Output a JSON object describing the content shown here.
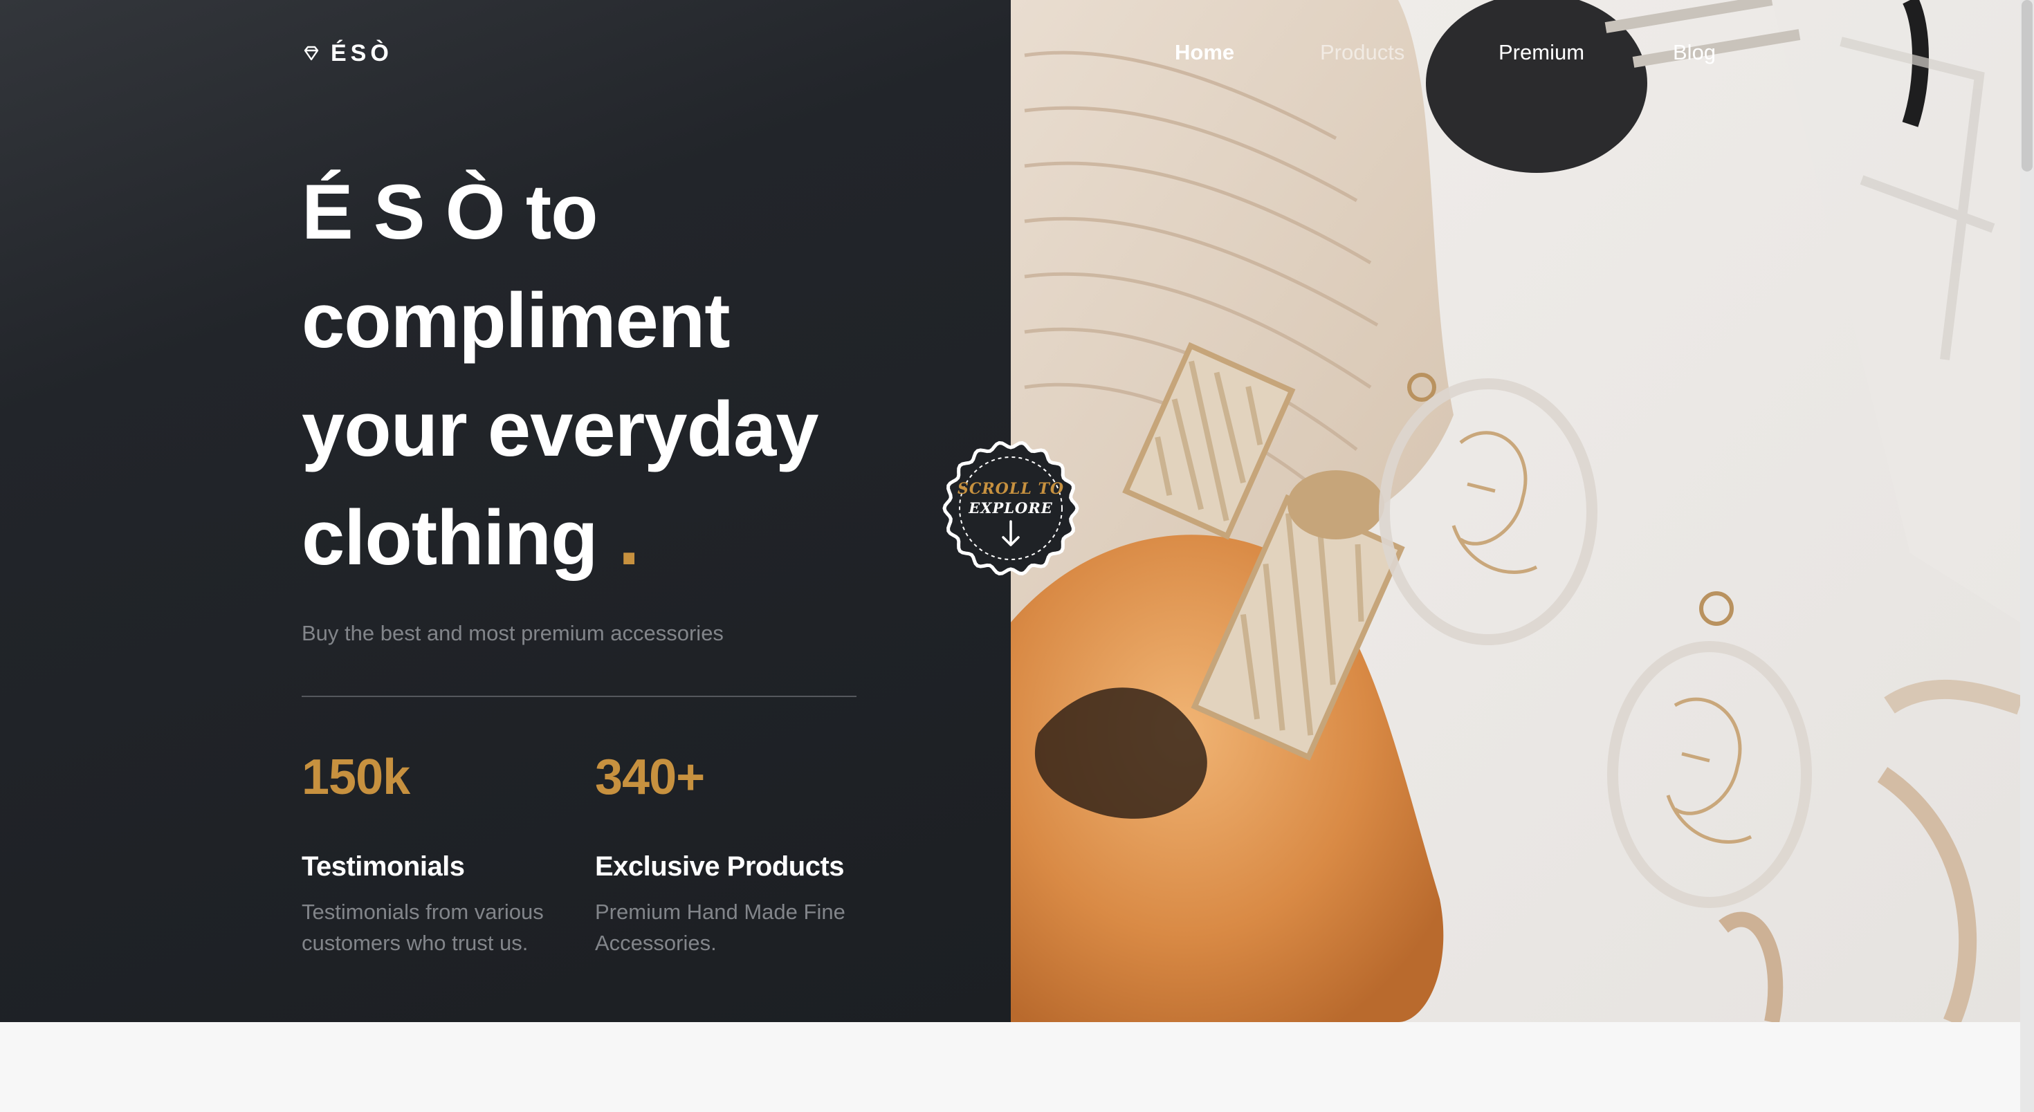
{
  "brand": {
    "logo_text": "ÉSÒ",
    "logo_icon": "diamond-icon"
  },
  "nav": {
    "items": [
      {
        "label": "Home",
        "active": true
      },
      {
        "label": "Products",
        "active": false
      },
      {
        "label": "Premium",
        "active": false
      },
      {
        "label": "Blog",
        "active": false
      }
    ]
  },
  "hero": {
    "headline_lines": [
      "É S Ò to",
      "compliment",
      "your everyday",
      "clothing"
    ],
    "headline_dot": ".",
    "subtitle": "Buy the best and most premium accessories",
    "stats": [
      {
        "value": "150k",
        "title": "Testimonials",
        "description_lines": [
          "Testimonials from various",
          "customers who trust us."
        ]
      },
      {
        "value": "340+",
        "title": "Exclusive Products",
        "description_lines": [
          "Premium Hand Made Fine",
          "Accessories."
        ]
      }
    ]
  },
  "scroll_badge": {
    "line1": "SCROLL TO",
    "line2": "EXPLORE",
    "icon": "arrow-down-icon"
  },
  "colors": {
    "accent": "#c7913f",
    "dark_bg": "#1f2226",
    "muted_text": "#82858a",
    "page_bg": "#f7f7f7"
  }
}
